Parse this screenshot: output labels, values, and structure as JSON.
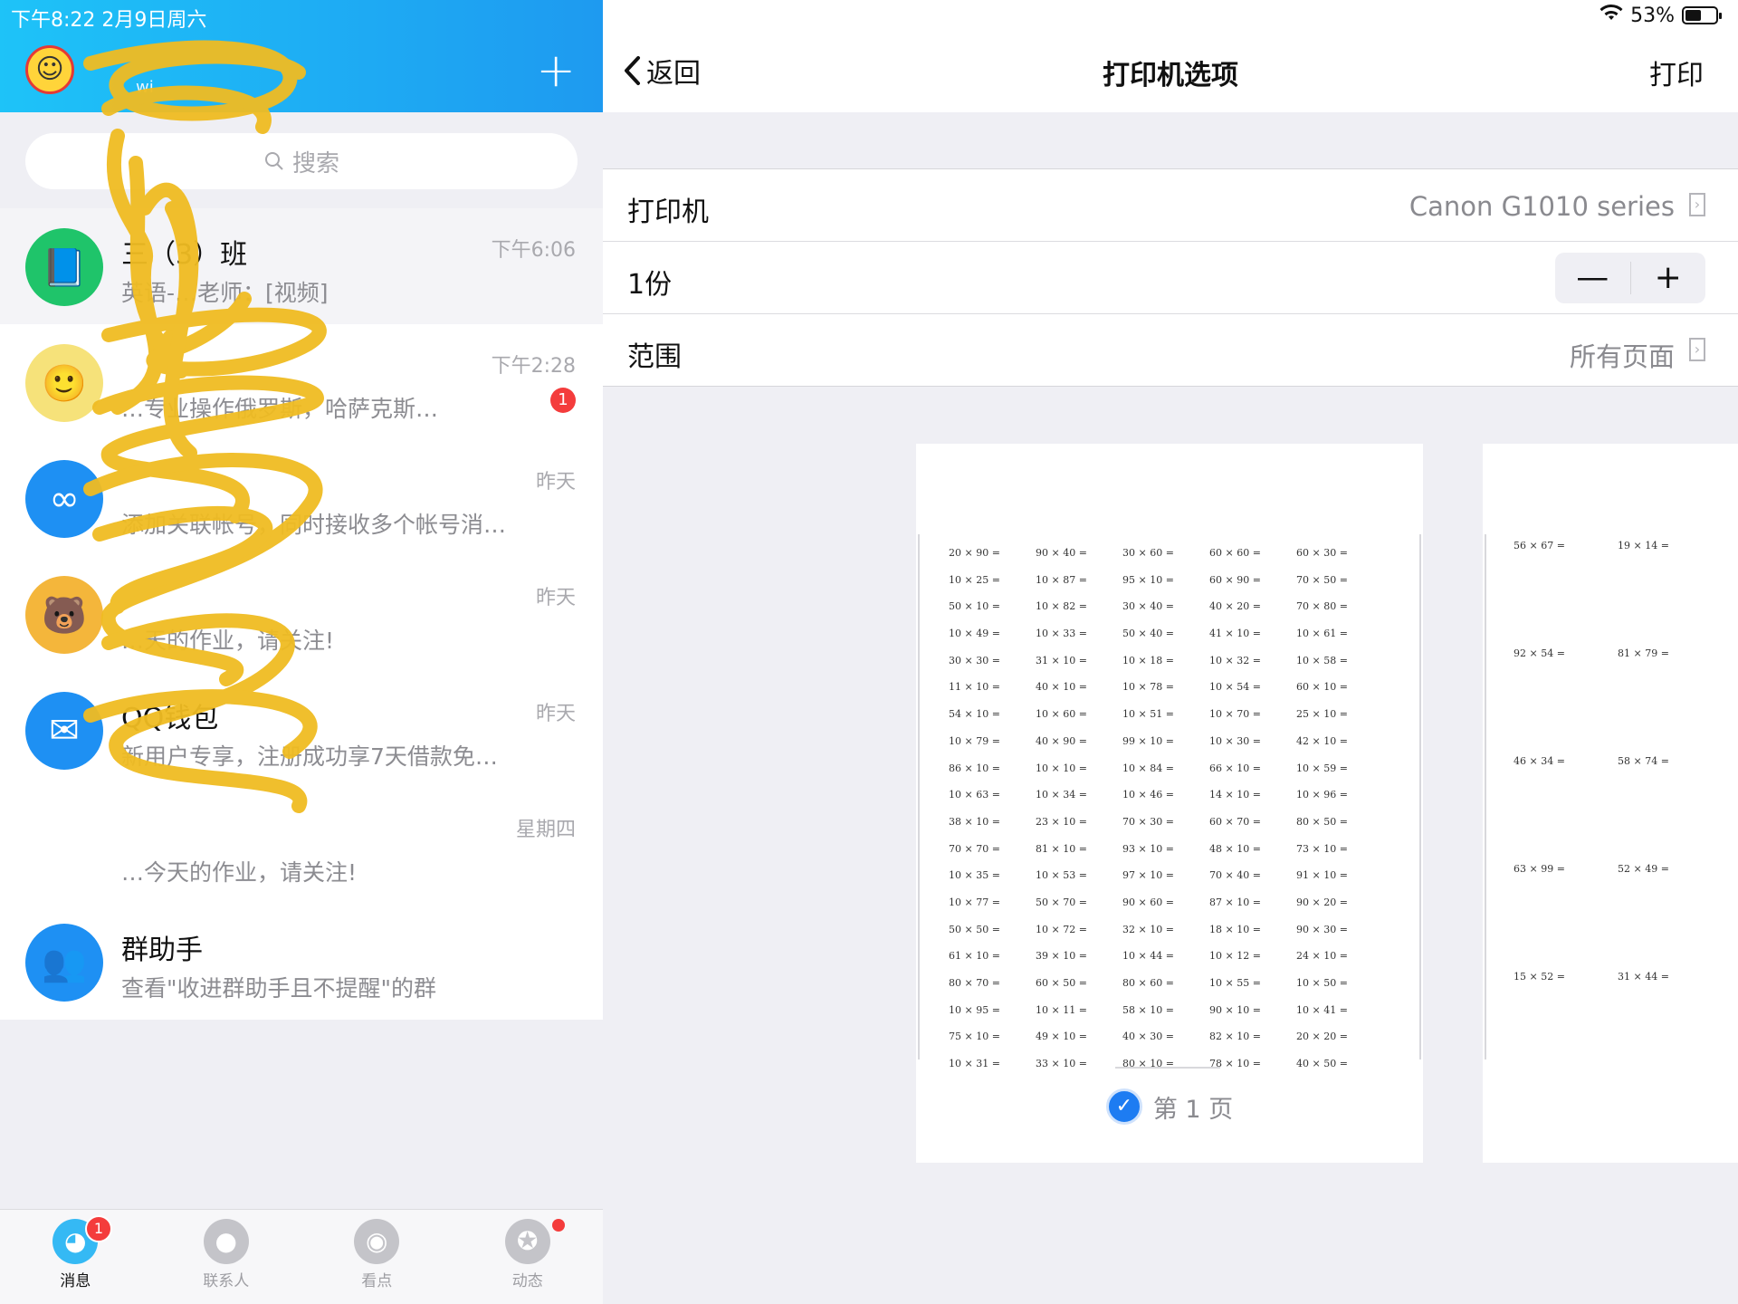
{
  "status": {
    "left": "下午8:22  2月9日周六",
    "battery_pct": "53%",
    "battery_level": 0.53
  },
  "left": {
    "sub": "wi",
    "search_placeholder": "搜索",
    "chats": [
      {
        "name": "三（3）班",
        "preview": "英语-…老师：[视频]",
        "time": "下午6:06",
        "badge": "",
        "color": "#1fc46a",
        "icon": "book-icon",
        "glyph": "📘"
      },
      {
        "name": "",
        "preview": "…专业操作俄罗斯，哈萨克斯…",
        "time": "下午2:28",
        "badge": "1",
        "color": "#f6e27a",
        "icon": "cartoon-face-icon",
        "glyph": "🙂"
      },
      {
        "name": "",
        "preview": "添加关联帐号，同时接收多个帐号消息。",
        "time": "昨天",
        "badge": "",
        "color": "#1e90f3",
        "icon": "linked-account-icon",
        "glyph": "∞"
      },
      {
        "name": "",
        "preview": "…天的作业，请关注!",
        "time": "昨天",
        "badge": "",
        "color": "#f4b63b",
        "icon": "bear-icon",
        "glyph": "🐻"
      },
      {
        "name": "QQ钱包",
        "preview": "新用户专享，注册成功享7天借款免息资格",
        "time": "昨天",
        "badge": "",
        "color": "#1e90f3",
        "icon": "wallet-icon",
        "glyph": "✉"
      },
      {
        "name": "",
        "preview": "…今天的作业，请关注!",
        "time": "星期四",
        "badge": "",
        "color": "#ffffff",
        "icon": "cartoon-logo-icon",
        "glyph": "🐱"
      },
      {
        "name": "群助手",
        "preview": "查看\"收进群助手且不提醒\"的群",
        "time": "",
        "badge": "",
        "color": "#1e90f3",
        "icon": "group-assistant-icon",
        "glyph": "👥"
      }
    ],
    "tabs": [
      {
        "label": "消息",
        "icon": "messages-icon",
        "badge": "1"
      },
      {
        "label": "联系人",
        "icon": "contacts-icon",
        "badge": ""
      },
      {
        "label": "看点",
        "icon": "eye-icon",
        "badge": ""
      },
      {
        "label": "动态",
        "icon": "planet-icon",
        "badge": ""
      }
    ]
  },
  "right": {
    "back": "返回",
    "title": "打印机选项",
    "print": "打印",
    "printer_label": "打印机",
    "printer_value": "Canon G1010 series",
    "copies_label": "1份",
    "minus": "—",
    "plus": "+",
    "range_label": "范围",
    "range_value": "所有页面",
    "page_label": "第 1 页",
    "sheet1_items": [
      "20 × 90 =",
      "90 × 40 =",
      "30 × 60 =",
      "60 × 60 =",
      "60 × 30 =",
      "10 × 25 =",
      "10 × 87 =",
      "95 × 10 =",
      "60 × 90 =",
      "70 × 50 =",
      "50 × 10 =",
      "10 × 82 =",
      "30 × 40 =",
      "40 × 20 =",
      "70 × 80 =",
      "10 × 49 =",
      "10 × 33 =",
      "50 × 40 =",
      "41 × 10 =",
      "10 × 61 =",
      "30 × 30 =",
      "31 × 10 =",
      "10 × 18 =",
      "10 × 32 =",
      "10 × 58 =",
      "11 × 10 =",
      "40 × 10 =",
      "10 × 78 =",
      "10 × 54 =",
      "60 × 10 =",
      "54 × 10 =",
      "10 × 60 =",
      "10 × 51 =",
      "10 × 70 =",
      "25 × 10 =",
      "10 × 79 =",
      "40 × 90 =",
      "99 × 10 =",
      "10 × 30 =",
      "42 × 10 =",
      "86 × 10 =",
      "10 × 10 =",
      "10 × 84 =",
      "66 × 10 =",
      "10 × 59 =",
      "10 × 63 =",
      "10 × 34 =",
      "10 × 46 =",
      "14 × 10 =",
      "10 × 96 =",
      "38 × 10 =",
      "23 × 10 =",
      "70 × 30 =",
      "60 × 70 =",
      "80 × 50 =",
      "70 × 70 =",
      "81 × 10 =",
      "93 × 10 =",
      "48 × 10 =",
      "73 × 10 =",
      "10 × 35 =",
      "10 × 53 =",
      "97 × 10 =",
      "70 × 40 =",
      "91 × 10 =",
      "10 × 77 =",
      "50 × 70 =",
      "90 × 60 =",
      "87 × 10 =",
      "90 × 20 =",
      "50 × 50 =",
      "10 × 72 =",
      "32 × 10 =",
      "18 × 10 =",
      "90 × 30 =",
      "61 × 10 =",
      "39 × 10 =",
      "10 × 44 =",
      "10 × 12 =",
      "24 × 10 =",
      "80 × 70 =",
      "60 × 50 =",
      "80 × 60 =",
      "10 × 55 =",
      "10 × 50 =",
      "10 × 95 =",
      "10 × 11 =",
      "58 × 10 =",
      "90 × 10 =",
      "10 × 41 =",
      "75 × 10 =",
      "49 × 10 =",
      "40 × 30 =",
      "82 × 10 =",
      "20 × 20 =",
      "10 × 31 =",
      "33 × 10 =",
      "80 × 10 =",
      "78 × 10 =",
      "40 × 50 ="
    ],
    "sheet2_items": [
      "56 × 67 =",
      "19 × 14 =",
      "92 × 54 =",
      "81 × 79 =",
      "46 × 34 =",
      "58 × 74 =",
      "63 × 99 =",
      "52 × 49 =",
      "15 × 52 =",
      "31 × 44 ="
    ]
  }
}
